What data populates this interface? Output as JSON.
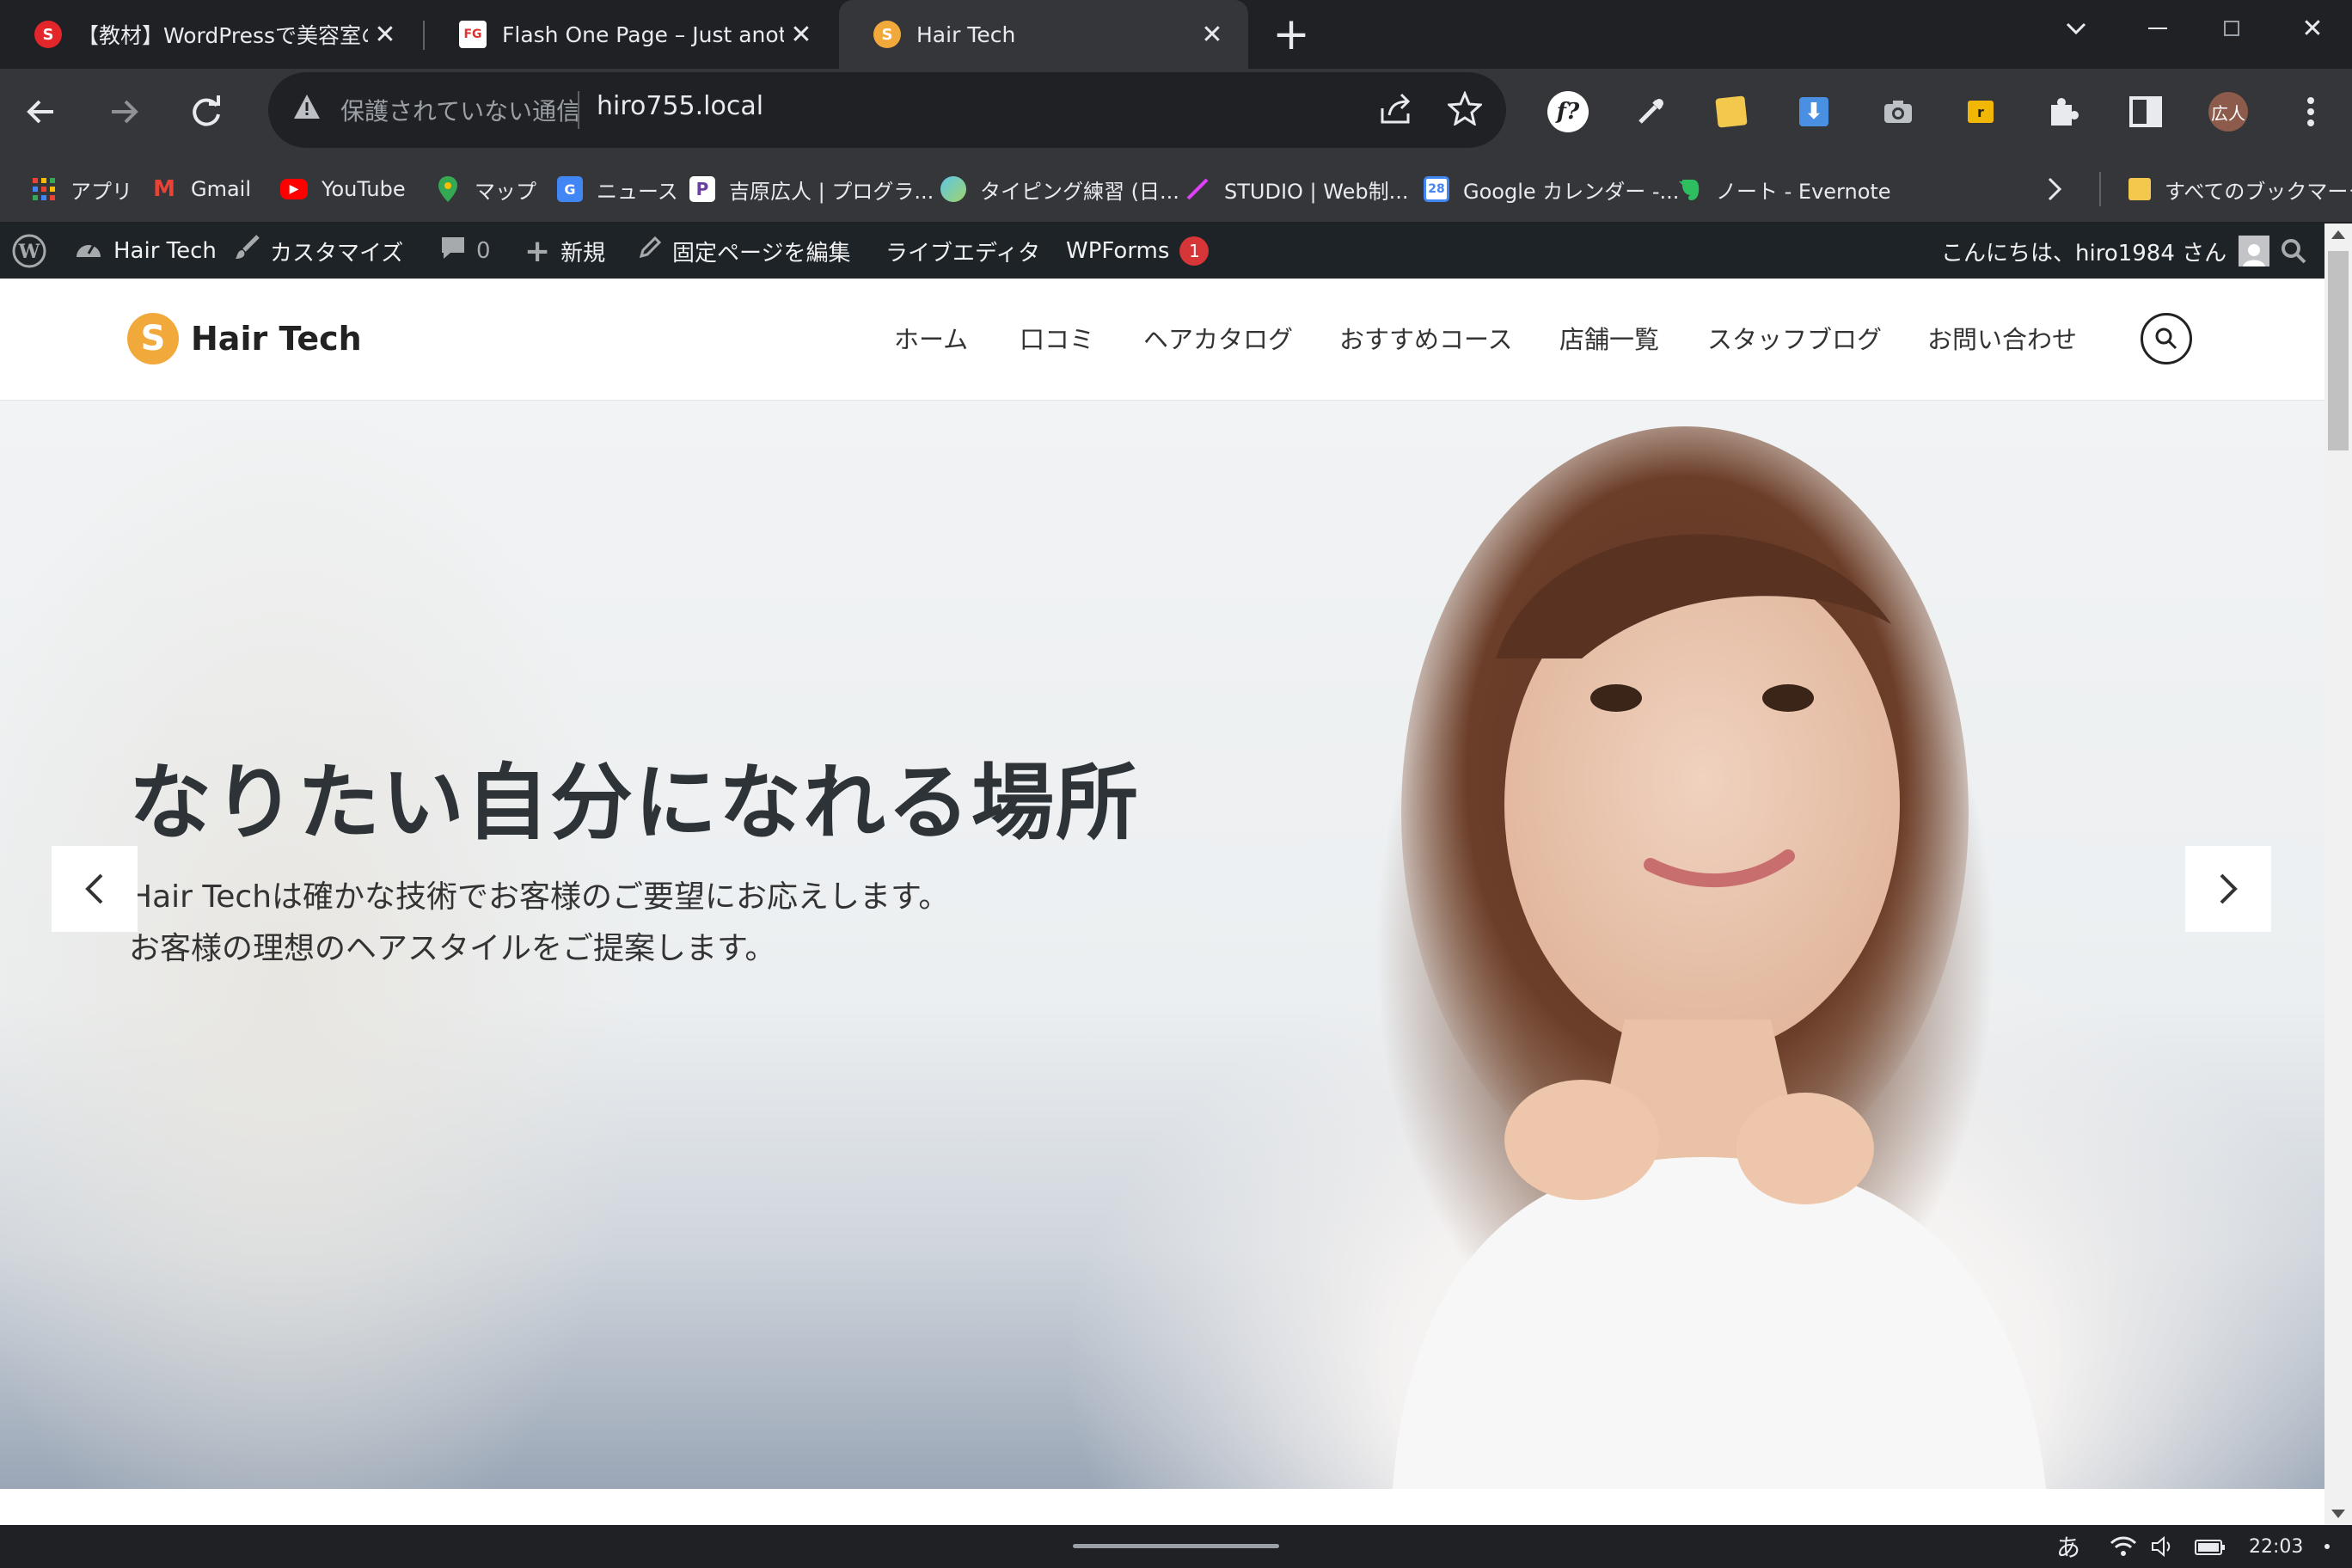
{
  "tabs": [
    {
      "title": "【教材】WordPressで美容室のサ",
      "favicon_color": "#e3262a"
    },
    {
      "title": "Flash One Page – Just anothe",
      "favicon_color": "#ffffff"
    },
    {
      "title": "Hair Tech",
      "favicon_color": "#f2a93b"
    }
  ],
  "new_tab_label": "+",
  "window": {
    "minimize": "—",
    "restore": "❐",
    "close": "✕",
    "dropdown": "⌄"
  },
  "toolbar": {
    "security_label": "保護されていない通信",
    "url": "hiro755.local",
    "profile_label": "広人"
  },
  "bookmarks": [
    {
      "label": "アプリ",
      "icon": "apps-grid-icon"
    },
    {
      "label": "Gmail",
      "icon": "gmail-icon"
    },
    {
      "label": "YouTube",
      "icon": "youtube-icon"
    },
    {
      "label": "マップ",
      "icon": "maps-icon"
    },
    {
      "label": "ニュース",
      "icon": "news-icon"
    },
    {
      "label": "吉原広人 | プログラ...",
      "icon": "p-icon"
    },
    {
      "label": "タイピング練習 (日...",
      "icon": "typing-icon"
    },
    {
      "label": "STUDIO | Web制...",
      "icon": "studio-icon"
    },
    {
      "label": "Google カレンダー -...",
      "icon": "calendar-icon"
    },
    {
      "label": "ノート - Evernote",
      "icon": "evernote-icon"
    }
  ],
  "all_bookmarks_label": "すべてのブックマーク",
  "adminbar": {
    "site_name": "Hair Tech",
    "customize": "カスタマイズ",
    "comments_count": "0",
    "new": "新規",
    "edit_page": "固定ページを編集",
    "live_editor": "ライブエディタ",
    "wpforms": "WPForms",
    "wpforms_badge": "1",
    "greeting": "こんにちは、hiro1984 さん"
  },
  "site": {
    "logo_text": "Hair Tech",
    "nav": [
      "ホーム",
      "口コミ",
      "ヘアカタログ",
      "おすすめコース",
      "店舗一覧",
      "スタッフブログ",
      "お問い合わせ"
    ]
  },
  "hero": {
    "title": "なりたい自分になれる場所",
    "subtitle_line1": "Hair Techは確かな技術でお客様のご要望にお応えします。",
    "subtitle_line2": "お客様の理想のヘアスタイルをご提案します。"
  },
  "taskbar": {
    "ime": "あ",
    "time": "22:03"
  },
  "colors": {
    "accent_orange": "#f2a93b",
    "admin_bar": "#1d2327",
    "badge_red": "#d63638"
  }
}
